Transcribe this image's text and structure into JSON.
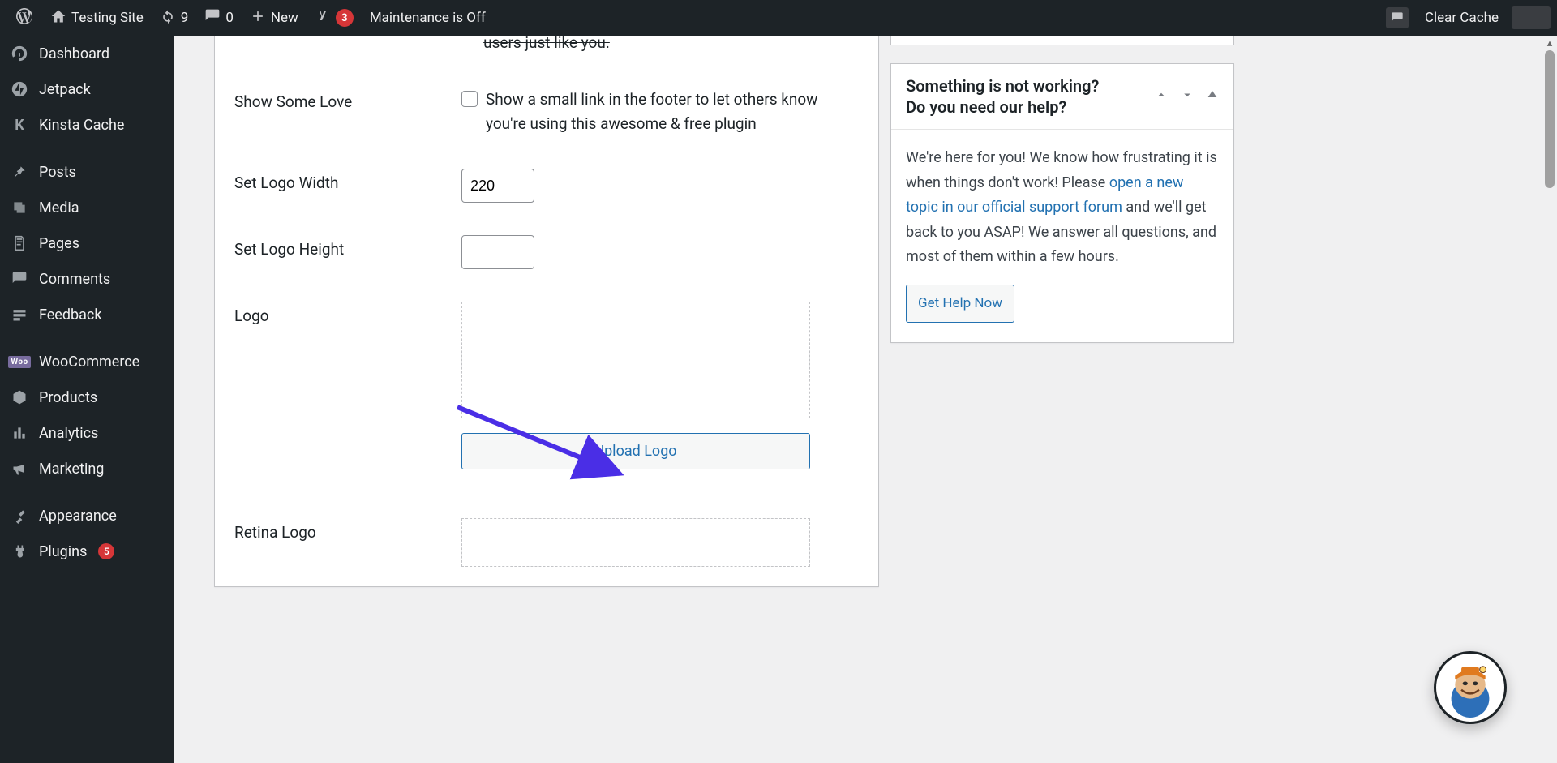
{
  "adminbar": {
    "site_title": "Testing Site",
    "updates_count": "9",
    "comments_count": "0",
    "new_label": "New",
    "seo_badge": "3",
    "maintenance_label": "Maintenance is Off",
    "clear_cache": "Clear Cache"
  },
  "sidebar": {
    "items": [
      {
        "label": "Dashboard"
      },
      {
        "label": "Jetpack"
      },
      {
        "label": "Kinsta Cache"
      },
      {
        "label": "Posts"
      },
      {
        "label": "Media"
      },
      {
        "label": "Pages"
      },
      {
        "label": "Comments"
      },
      {
        "label": "Feedback"
      },
      {
        "label": "WooCommerce"
      },
      {
        "label": "Products"
      },
      {
        "label": "Analytics"
      },
      {
        "label": "Marketing"
      },
      {
        "label": "Appearance"
      },
      {
        "label": "Plugins"
      }
    ],
    "plugins_count": "5"
  },
  "form": {
    "hidden_partial": "users just like you.",
    "show_love_label": "Show Some Love",
    "show_love_desc": "Show a small link in the footer to let others know you're using this awesome & free plugin",
    "logo_width_label": "Set Logo Width",
    "logo_width_value": "220",
    "logo_height_label": "Set Logo Height",
    "logo_height_value": "",
    "logo_label": "Logo",
    "upload_logo_btn": "Upload Logo",
    "retina_logo_label": "Retina Logo"
  },
  "help": {
    "title_line1": "Something is not working?",
    "title_line2": "Do you need our help?",
    "body_part1": "We're here for you! We know how frustrating it is when things don't work! Please ",
    "body_link": "open a new topic in our official support forum",
    "body_part2": " and we'll get back to you ASAP! We answer all questions, and most of them within a few hours.",
    "button": "Get Help Now"
  }
}
